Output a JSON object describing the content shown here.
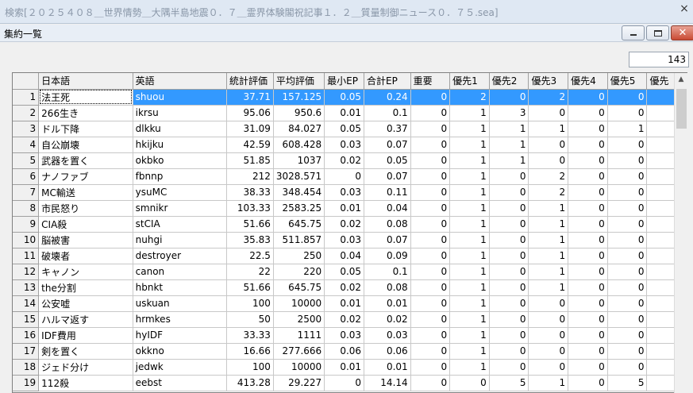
{
  "window": {
    "outer_title": "検索[２０２５４０８＿世界情勢＿大隅半島地震０．７＿霊界体験閣祝記事１．２＿質量制御ニュース０．７５.sea]",
    "outer_close": "×",
    "inner_title": "集約一覧",
    "close_glyph": "✕"
  },
  "count": "143",
  "table": {
    "columns": [
      "日本語",
      "英語",
      "統計評価",
      "平均評価",
      "最小EP",
      "合計EP",
      "重要",
      "優先1",
      "優先2",
      "優先3",
      "優先4",
      "優先5",
      "優先"
    ],
    "rows": [
      {
        "n": "1",
        "cells": [
          "法王死",
          "shuou",
          "37.71",
          "157.125",
          "0.05",
          "0.24",
          "0",
          "2",
          "0",
          "2",
          "0",
          "0",
          ""
        ]
      },
      {
        "n": "2",
        "cells": [
          "266生き",
          "ikrsu",
          "95.06",
          "950.6",
          "0.01",
          "0.1",
          "0",
          "1",
          "3",
          "0",
          "0",
          "0",
          ""
        ]
      },
      {
        "n": "3",
        "cells": [
          "ドル下降",
          "dlkku",
          "31.09",
          "84.027",
          "0.05",
          "0.37",
          "0",
          "1",
          "1",
          "1",
          "0",
          "1",
          ""
        ]
      },
      {
        "n": "4",
        "cells": [
          "自公崩壊",
          "hkijku",
          "42.59",
          "608.428",
          "0.03",
          "0.07",
          "0",
          "1",
          "1",
          "0",
          "0",
          "0",
          ""
        ]
      },
      {
        "n": "5",
        "cells": [
          "武器を置く",
          "okbko",
          "51.85",
          "1037",
          "0.02",
          "0.05",
          "0",
          "1",
          "1",
          "0",
          "0",
          "0",
          ""
        ]
      },
      {
        "n": "6",
        "cells": [
          "ナノファブ",
          "fbnnp",
          "212",
          "3028.571",
          "0",
          "0.07",
          "0",
          "1",
          "0",
          "2",
          "0",
          "0",
          ""
        ]
      },
      {
        "n": "7",
        "cells": [
          "MC輸送",
          "ysuMC",
          "38.33",
          "348.454",
          "0.03",
          "0.11",
          "0",
          "1",
          "0",
          "2",
          "0",
          "0",
          ""
        ]
      },
      {
        "n": "8",
        "cells": [
          "市民怒り",
          "smnikr",
          "103.33",
          "2583.25",
          "0.01",
          "0.04",
          "0",
          "1",
          "0",
          "1",
          "0",
          "0",
          ""
        ]
      },
      {
        "n": "9",
        "cells": [
          "CIA殺",
          "stCIA",
          "51.66",
          "645.75",
          "0.02",
          "0.08",
          "0",
          "1",
          "0",
          "1",
          "0",
          "0",
          ""
        ]
      },
      {
        "n": "10",
        "cells": [
          "脳被害",
          "nuhgi",
          "35.83",
          "511.857",
          "0.03",
          "0.07",
          "0",
          "1",
          "0",
          "1",
          "0",
          "0",
          ""
        ]
      },
      {
        "n": "11",
        "cells": [
          "破壊者",
          "destroyer",
          "22.5",
          "250",
          "0.04",
          "0.09",
          "0",
          "1",
          "0",
          "1",
          "0",
          "0",
          ""
        ]
      },
      {
        "n": "12",
        "cells": [
          "キャノン",
          "canon",
          "22",
          "220",
          "0.05",
          "0.1",
          "0",
          "1",
          "0",
          "1",
          "0",
          "0",
          ""
        ]
      },
      {
        "n": "13",
        "cells": [
          "the分割",
          "hbnkt",
          "51.66",
          "645.75",
          "0.02",
          "0.08",
          "0",
          "1",
          "0",
          "1",
          "0",
          "0",
          ""
        ]
      },
      {
        "n": "14",
        "cells": [
          "公安嘘",
          "uskuan",
          "100",
          "10000",
          "0.01",
          "0.01",
          "0",
          "1",
          "0",
          "0",
          "0",
          "0",
          ""
        ]
      },
      {
        "n": "15",
        "cells": [
          "ハルマ返す",
          "hrmkes",
          "50",
          "2500",
          "0.02",
          "0.02",
          "0",
          "1",
          "0",
          "0",
          "0",
          "0",
          ""
        ]
      },
      {
        "n": "16",
        "cells": [
          "IDF費用",
          "hyIDF",
          "33.33",
          "1111",
          "0.03",
          "0.03",
          "0",
          "1",
          "0",
          "0",
          "0",
          "0",
          ""
        ]
      },
      {
        "n": "17",
        "cells": [
          "剣を置く",
          "okkno",
          "16.66",
          "277.666",
          "0.06",
          "0.06",
          "0",
          "1",
          "0",
          "0",
          "0",
          "0",
          ""
        ]
      },
      {
        "n": "18",
        "cells": [
          "ジェド分け",
          "jedwk",
          "100",
          "10000",
          "0.01",
          "0.01",
          "0",
          "1",
          "0",
          "0",
          "0",
          "0",
          ""
        ]
      },
      {
        "n": "19",
        "cells": [
          "112殺",
          "eebst",
          "413.28",
          "29.227",
          "0",
          "14.14",
          "0",
          "0",
          "5",
          "1",
          "0",
          "5",
          ""
        ]
      }
    ]
  }
}
